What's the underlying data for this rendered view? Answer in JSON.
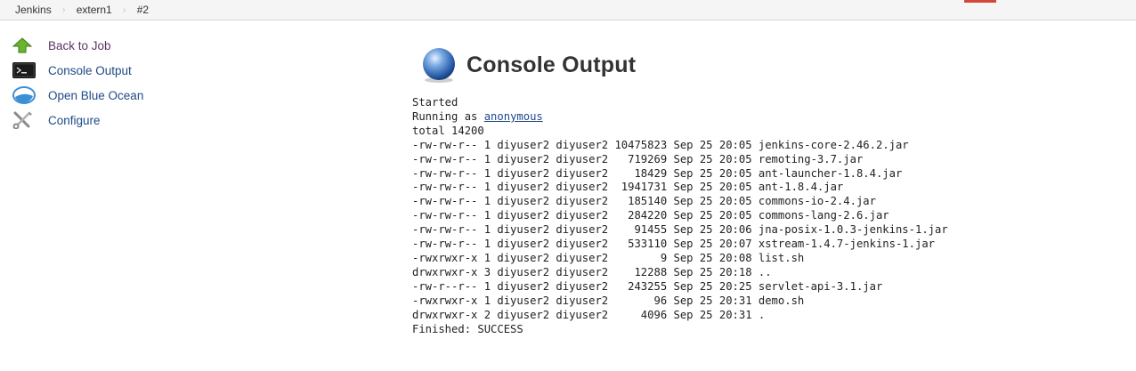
{
  "breadcrumb": {
    "items": [
      "Jenkins",
      "extern1",
      "#2"
    ],
    "separator": "›"
  },
  "sidebar": {
    "items": [
      {
        "label": "Back to Job",
        "icon": "up-arrow-icon"
      },
      {
        "label": "Console Output",
        "icon": "terminal-icon"
      },
      {
        "label": "Open Blue Ocean",
        "icon": "blue-ocean-icon"
      },
      {
        "label": "Configure",
        "icon": "wrench-screwdriver-icon"
      }
    ]
  },
  "main": {
    "title": "Console Output",
    "title_icon": "blue-orb-icon"
  },
  "console": {
    "started": "Started",
    "running_as_prefix": "Running as ",
    "user_link": "anonymous",
    "total": "total 14200",
    "files": [
      "-rw-rw-r-- 1 diyuser2 diyuser2 10475823 Sep 25 20:05 jenkins-core-2.46.2.jar",
      "-rw-rw-r-- 1 diyuser2 diyuser2   719269 Sep 25 20:05 remoting-3.7.jar",
      "-rw-rw-r-- 1 diyuser2 diyuser2    18429 Sep 25 20:05 ant-launcher-1.8.4.jar",
      "-rw-rw-r-- 1 diyuser2 diyuser2  1941731 Sep 25 20:05 ant-1.8.4.jar",
      "-rw-rw-r-- 1 diyuser2 diyuser2   185140 Sep 25 20:05 commons-io-2.4.jar",
      "-rw-rw-r-- 1 diyuser2 diyuser2   284220 Sep 25 20:05 commons-lang-2.6.jar",
      "-rw-rw-r-- 1 diyuser2 diyuser2    91455 Sep 25 20:06 jna-posix-1.0.3-jenkins-1.jar",
      "-rw-rw-r-- 1 diyuser2 diyuser2   533110 Sep 25 20:07 xstream-1.4.7-jenkins-1.jar",
      "-rwxrwxr-x 1 diyuser2 diyuser2        9 Sep 25 20:08 list.sh",
      "drwxrwxr-x 3 diyuser2 diyuser2    12288 Sep 25 20:18 ..",
      "-rw-r--r-- 1 diyuser2 diyuser2   243255 Sep 25 20:25 servlet-api-3.1.jar",
      "-rwxrwxr-x 1 diyuser2 diyuser2       96 Sep 25 20:31 demo.sh",
      "drwxrwxr-x 2 diyuser2 diyuser2     4096 Sep 25 20:31 ."
    ],
    "finished": "Finished: SUCCESS"
  },
  "colors": {
    "link": "#204a87",
    "visited_link": "#5c3566",
    "accent": "#d24939"
  }
}
